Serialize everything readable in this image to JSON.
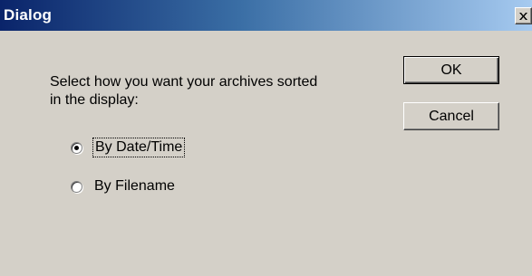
{
  "window": {
    "title": "Dialog",
    "close_glyph": "✕"
  },
  "prompt": {
    "line1": "Select how you want your archives sorted",
    "line2": "in the display:"
  },
  "sort_options": [
    {
      "label": "By Date/Time",
      "selected": true
    },
    {
      "label": "By Filename",
      "selected": false
    }
  ],
  "buttons": {
    "ok": "OK",
    "cancel": "Cancel"
  },
  "colors": {
    "title_start": "#0a246a",
    "title_end": "#a6caf0",
    "face": "#d4d0c8"
  }
}
